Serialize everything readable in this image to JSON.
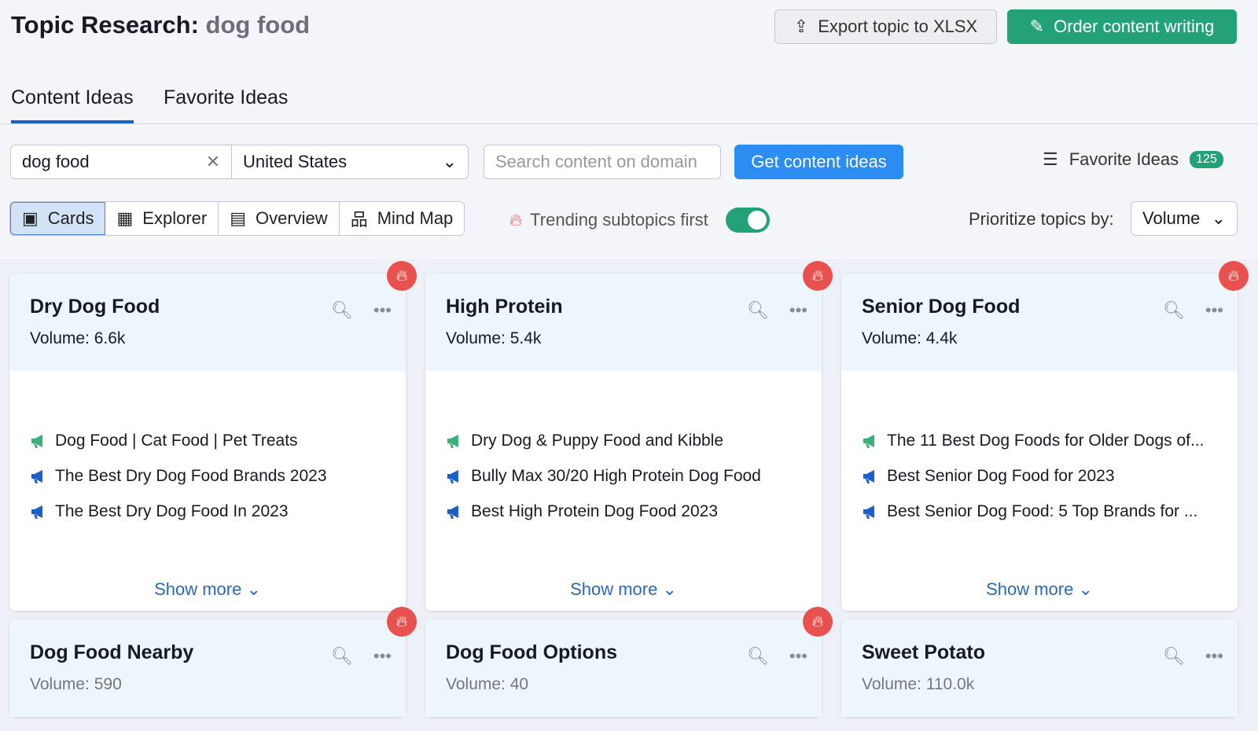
{
  "header": {
    "title": "Topic Research:",
    "keyword": "dog food"
  },
  "actions": {
    "export": "Export topic to XLSX",
    "order": "Order content writing"
  },
  "tabs": [
    {
      "label": "Content Ideas",
      "active": true
    },
    {
      "label": "Favorite Ideas",
      "active": false
    }
  ],
  "search": {
    "keyword_value": "dog food",
    "country": "United States",
    "domain_placeholder": "Search content on domain",
    "get_button": "Get content ideas"
  },
  "favorites": {
    "label": "Favorite Ideas",
    "count": "125"
  },
  "views": [
    {
      "label": "Cards",
      "icon": "cards-icon",
      "active": true
    },
    {
      "label": "Explorer",
      "icon": "table-icon"
    },
    {
      "label": "Overview",
      "icon": "overview-icon"
    },
    {
      "label": "Mind Map",
      "icon": "mind-map-icon"
    }
  ],
  "trending": {
    "label": "Trending subtopics first",
    "enabled": true
  },
  "prioritize": {
    "label": "Prioritize topics by:",
    "value": "Volume"
  },
  "colors": {
    "accent": "#2b8cf2",
    "green": "#23a27a",
    "flame": "#e9514f"
  },
  "volume_label": "Volume:",
  "show_more": "Show more",
  "cards": [
    {
      "title": "Dry Dog Food",
      "volume": "6.6k",
      "trending": true,
      "headlines": [
        "Dog Food | Cat Food | Pet Treats",
        "The Best Dry Dog Food Brands 2023",
        "The Best Dry Dog Food In 2023"
      ]
    },
    {
      "title": "High Protein",
      "volume": "5.4k",
      "trending": true,
      "headlines": [
        "Dry Dog & Puppy Food and Kibble",
        "Bully Max 30/20 High Protein Dog Food",
        "Best High Protein Dog Food 2023"
      ]
    },
    {
      "title": "Senior Dog Food",
      "volume": "4.4k",
      "trending": true,
      "headlines": [
        "The 11 Best Dog Foods for Older Dogs of...",
        "Best Senior Dog Food for 2023",
        "Best Senior Dog Food: 5 Top Brands for ..."
      ]
    },
    {
      "title": "Dog Food Nearby",
      "volume": "590",
      "trending": true
    },
    {
      "title": "Dog Food Options",
      "volume": "40",
      "trending": true
    },
    {
      "title": "Sweet Potato",
      "volume": "110.0k",
      "trending": false
    }
  ]
}
